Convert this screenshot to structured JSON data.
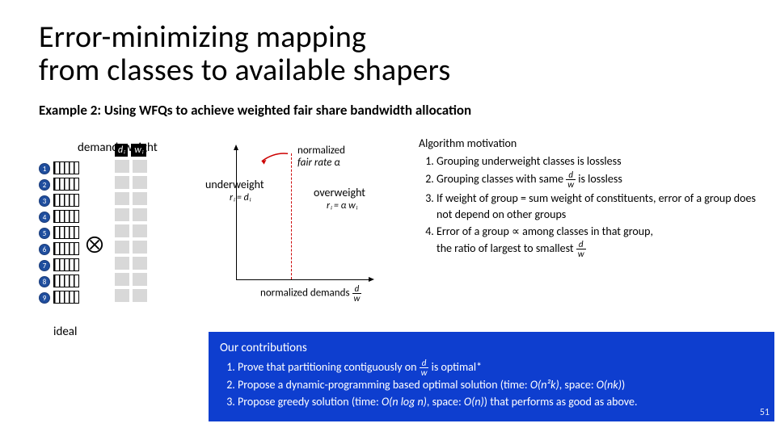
{
  "title_line1": "Error-minimizing mapping",
  "title_line2": "from classes to available shapers",
  "subtitle": "Example 2: Using WFQs to achieve weighted fair share bandwidth allocation",
  "demand_label": "demand, weight",
  "dw_head_d": "dᵢ",
  "dw_head_w": "wᵢ",
  "circles": [
    "1",
    "2",
    "3",
    "4",
    "5",
    "6",
    "7",
    "8",
    "9"
  ],
  "ideal": "ideal",
  "graph": {
    "norm_fair": "normalized",
    "norm_fair2": "fair rate α",
    "under": "underweight",
    "under_eq": "rᵢ = dᵢ",
    "over": "overweight",
    "over_eq": "rᵢ = α wᵢ",
    "norm_dem": "normalized demands",
    "frac_n": "d",
    "frac_d": "w"
  },
  "motivation": {
    "title": "Algorithm motivation",
    "items": [
      "Grouping underweight classes is lossless",
      "Grouping classes with same d/w is lossless",
      "If weight of group = sum weight of constituents, error of a group does not depend on other groups",
      "Error of a group ∝ among classes in that group, the ratio of largest to smallest d/w"
    ]
  },
  "contrib": {
    "title": "Our contributions",
    "items": [
      "Prove that partitioning contiguously on d/w is optimal*",
      "Propose a dynamic-programming based optimal solution (time: O(n²k), space: O(nk))",
      "Propose greedy solution (time: O(n log n), space: O(n)) that performs as good as above."
    ],
    "page": "51"
  }
}
